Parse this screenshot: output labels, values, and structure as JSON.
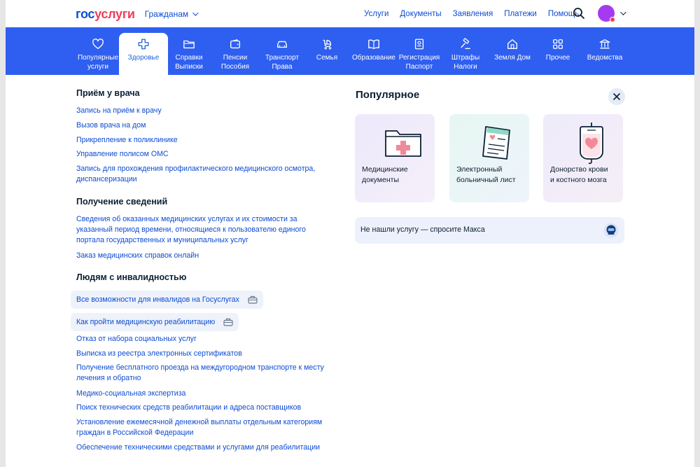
{
  "header": {
    "logo_part1": "гос",
    "logo_part2": "услуги",
    "audience": "Гражданам",
    "nav": [
      "Услуги",
      "Документы",
      "Заявления",
      "Платежи",
      "Помощь"
    ]
  },
  "categories": [
    {
      "line1": "Популярные",
      "line2": "услуги",
      "icon": "heart-icon"
    },
    {
      "line1": "Здоровье",
      "line2": "",
      "icon": "plus-cross-icon",
      "active": true
    },
    {
      "line1": "Справки",
      "line2": "Выписки",
      "icon": "folder-icon"
    },
    {
      "line1": "Пенсии",
      "line2": "Пособия",
      "icon": "wallet-icon"
    },
    {
      "line1": "Транспорт",
      "line2": "Права",
      "icon": "car-icon"
    },
    {
      "line1": "Семья",
      "line2": "",
      "icon": "stroller-icon"
    },
    {
      "line1": "Образование",
      "line2": "",
      "icon": "book-icon"
    },
    {
      "line1": "Регистрация",
      "line2": "Паспорт",
      "icon": "passport-icon"
    },
    {
      "line1": "Штрафы",
      "line2": "Налоги",
      "icon": "gavel-icon"
    },
    {
      "line1": "Земля Дом",
      "line2": "",
      "icon": "house-icon"
    },
    {
      "line1": "Прочее",
      "line2": "",
      "icon": "grid-icon"
    },
    {
      "line1": "Ведомства",
      "line2": "",
      "icon": "building-icon"
    }
  ],
  "sections": {
    "doctor": {
      "title": "Приём у врача",
      "links": [
        "Запись на приём к врачу",
        "Вызов врача на дом",
        "Прикрепление к поликлинике",
        "Управление полисом ОМС",
        "Запись для прохождения профилактического медицинского осмотра, диспансеризации"
      ]
    },
    "info": {
      "title": "Получение сведений",
      "links": [
        "Сведения об оказанных медицинских услугах и их стоимости за указанный период времени, относящиеся к пользователю единого портала государственных и муниципальных услуг",
        "Заказ медицинских справок онлайн"
      ]
    },
    "disability": {
      "title": "Людям с инвалидностью",
      "pills": [
        "Все возможности для инвалидов на Госуслугах",
        "Как пройти медицинскую реабилитацию"
      ],
      "links": [
        "Отказ от набора социальных услуг",
        "Выписка из реестра электронных сертификатов",
        "Получение бесплатного проезда на междугородном транспорте к месту лечения и обратно",
        "Медико-социальная экспертиза",
        "Поиск технических средств реабилитации и адреса поставщиков",
        "Установление ежемесячной денежной выплаты отдельным категориям граждан в Российской Федерации",
        "Обеспечение техническими средствами и услугами для реабилитации"
      ]
    }
  },
  "popular": {
    "title": "Популярное",
    "cards": [
      {
        "line1": "Медицинские",
        "line2": "документы",
        "icon": "medical-folder-icon"
      },
      {
        "line1": "Электронный",
        "line2": "больничный лист",
        "icon": "sick-leave-icon"
      },
      {
        "line1": "Донорство крови",
        "line2": "и костного мозга",
        "icon": "blood-bag-icon"
      }
    ],
    "ask_text": "Не нашли услугу — спросите Макса"
  },
  "colors": {
    "brand_blue": "#0d4cd3",
    "brand_red": "#ee3f58",
    "category_bar": "#2f5ff0",
    "avatar": "#a53bf0"
  }
}
